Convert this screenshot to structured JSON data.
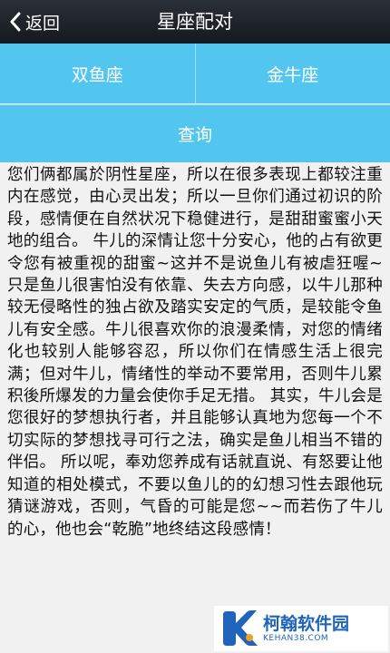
{
  "header": {
    "back_label": "返回",
    "title": "星座配对"
  },
  "selectors": {
    "sign_a": "双鱼座",
    "sign_b": "金牛座"
  },
  "query_label": "查询",
  "result_text": "您们俩都属於阴性星座，所以在很多表现上都较注重内在感觉，由心灵出发；所以一旦你们通过初识的阶段，感情便在自然状况下稳健进行，是甜甜蜜蜜小天地的组合。 牛儿的深情让您十分安心，他的占有欲更令您有被重视的甜蜜~这并不是说鱼儿有被虐狂喔~只是鱼儿很害怕没有依靠、失去方向感，以牛儿那种较无侵略性的独占欲及踏实安定的气质，是较能令鱼儿有安全感。牛儿很喜欢你的浪漫柔情，对您的情绪化也较别人能够容忍，所以你们在情感生活上很完满；但对牛儿，情绪性的举动不要常用，否则牛儿累积後所爆发的力量会使你手足无措。 其实，牛儿会是您很好的梦想执行者，并且能够认真地为您每一个不切实际的梦想找寻可行之法，确实是鱼儿相当不错的伴侣。 所以呢，奉劝您养成有话就直说、有怒要让他知道的相处模式，不要以鱼儿的的幻想习性去跟他玩猜谜游戏，否则，气昏的可能是您~~而若伤了牛儿的心，他也会“乾脆”地终结这段感情！",
  "watermark": {
    "name": "柯翰软件园",
    "domain": "KEHAN38.COM"
  },
  "colors": {
    "accent": "#52c6ee",
    "topbar": "#1c2128",
    "watermark": "#1f64b8"
  }
}
